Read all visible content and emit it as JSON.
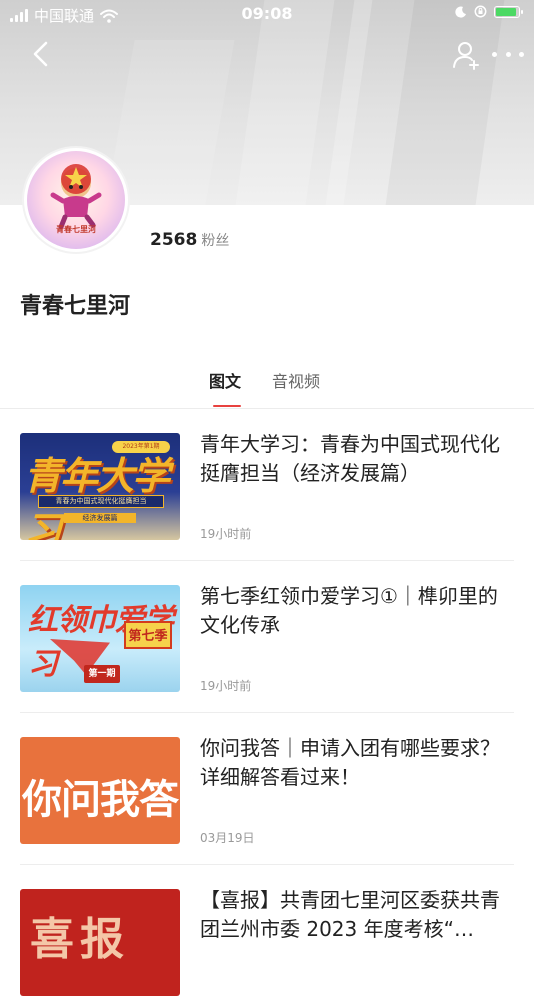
{
  "status_bar": {
    "carrier": "中国联通",
    "time": "09:08",
    "battery_color": "#4cd964",
    "battery_level": 0.85
  },
  "header": {
    "fans_count": "2568",
    "fans_label": "粉丝",
    "account_name": "青春七里河",
    "avatar_caption": "青春七里河"
  },
  "tabs": [
    {
      "label": "图文",
      "active": true
    },
    {
      "label": "音视频",
      "active": false
    }
  ],
  "accent_color": "#e8423f",
  "articles": [
    {
      "title": "青年大学习：青春为中国式现代化挺膺担当（经济发展篇）",
      "time": "19小时前",
      "thumb": {
        "big": "青年大学习",
        "year": "2023年第1期",
        "sub": "青春为中国式现代化挺膺担当",
        "sub2": "经济发展篇"
      }
    },
    {
      "title": "第七季红领巾爱学习①｜榫卯里的文化传承",
      "time": "19小时前",
      "thumb": {
        "big": "红领巾爱学习",
        "season": "第七季",
        "episode": "第一期"
      }
    },
    {
      "title": "你问我答｜申请入团有哪些要求？详细解答看过来！",
      "time": "03月19日",
      "thumb": {
        "big": "你问我答"
      }
    },
    {
      "title": "【喜报】共青团七里河区委获共青团兰州市委 2023 年度考核“…",
      "time": "",
      "thumb": {
        "big": "喜报"
      }
    }
  ]
}
